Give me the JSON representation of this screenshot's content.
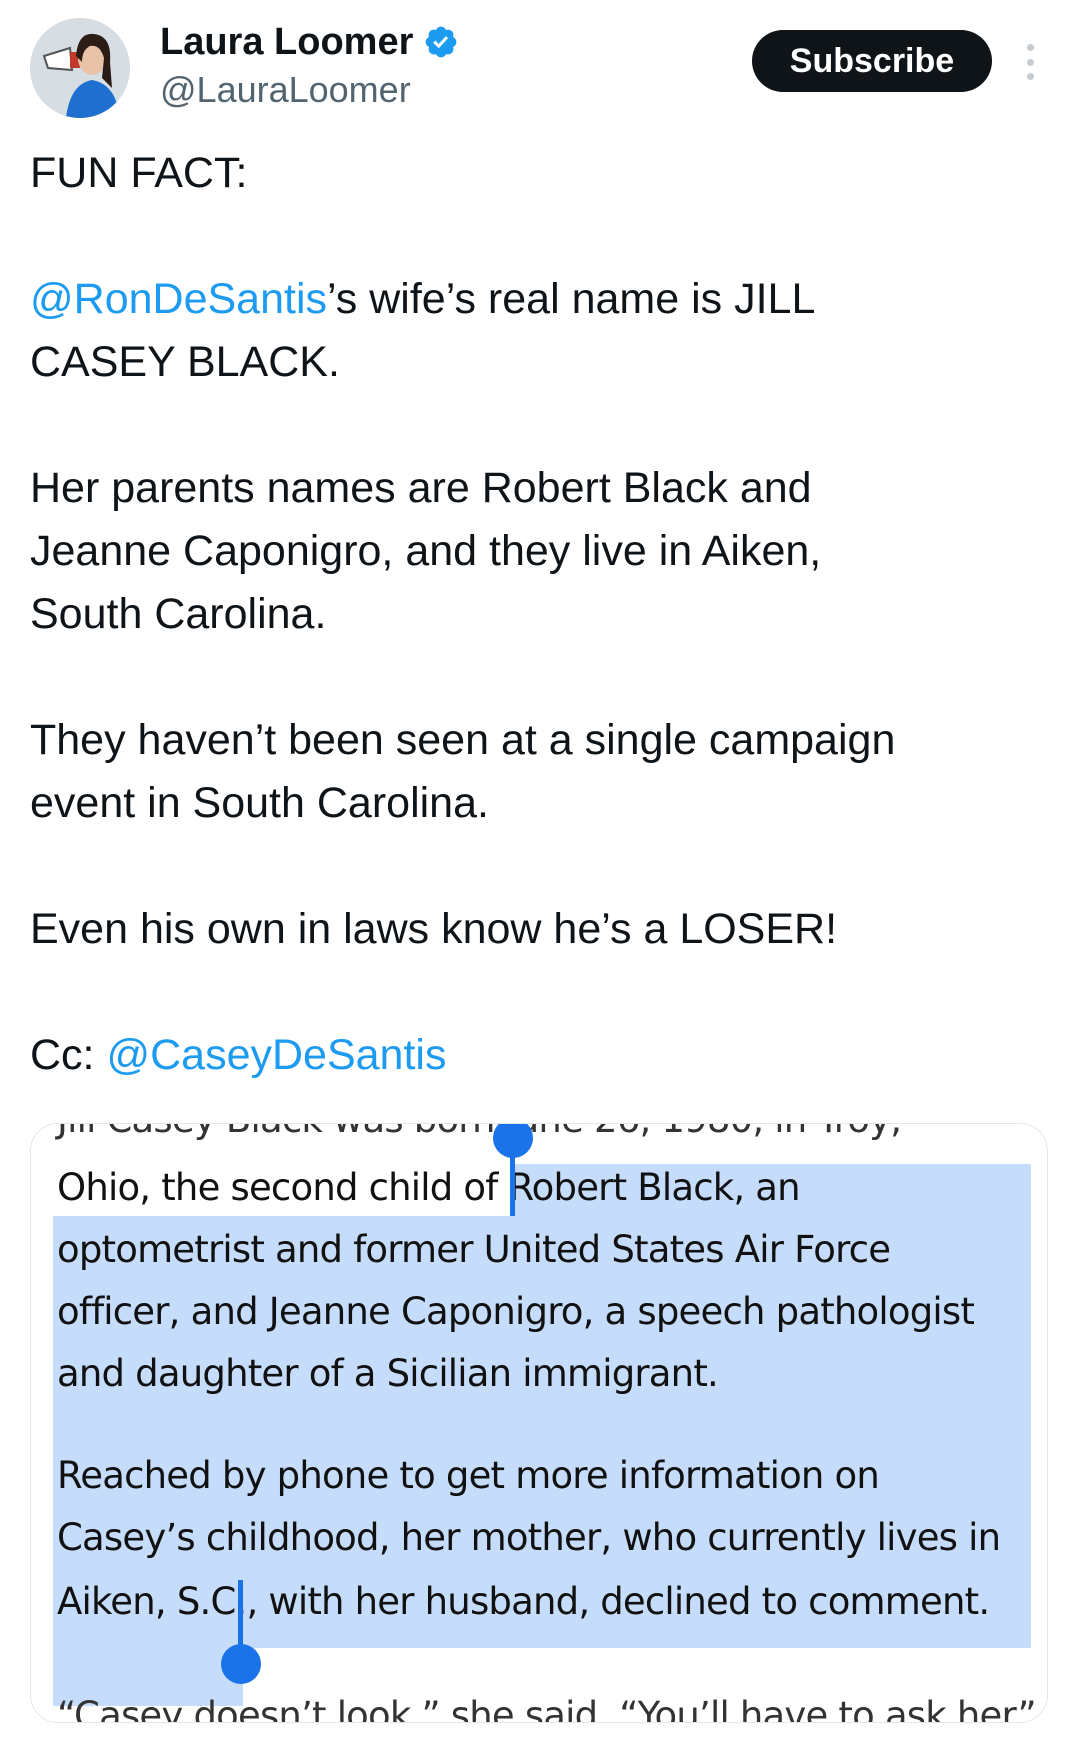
{
  "author": {
    "display_name": "Laura Loomer",
    "handle": "@LauraLoomer",
    "verified_icon": "verified-badge-icon",
    "avatar_icon": "avatar-image"
  },
  "actions": {
    "subscribe_label": "Subscribe",
    "more_icon": "more-options-icon"
  },
  "tweet": {
    "line1": "FUN FACT:",
    "p2_mention": "@RonDeSantis",
    "p2_rest_a": "’s wife’s real name is JILL",
    "p2_rest_b": "CASEY BLACK.",
    "p3_a": "Her parents names are Robert Black and",
    "p3_b": "Jeanne Caponigro, and they live in Aiken,",
    "p3_c": "South Carolina.",
    "p4_a": "They haven’t been seen at a single campaign",
    "p4_b": "event in South Carolina.",
    "p5": "Even his own in laws know he’s a LOSER!",
    "cc_label": "Cc: ",
    "cc_mention": "@CaseyDeSantis"
  },
  "media": {
    "lines": [
      "Ohio, the second child of Robert Black, an",
      "optometrist and former United States Air Force",
      "officer, and Jeanne Caponigro, a speech pathologist",
      "and daughter of a Sicilian immigrant.",
      "Reached by phone to get more information on",
      "Casey’s childhood, her mother, who currently lives in",
      "Aiken, S.C., with her husband, declined to comment."
    ]
  },
  "colors": {
    "mention": "#1d9bf0",
    "highlight": "#c5dcfb",
    "selection_handle": "#1a73e8"
  }
}
